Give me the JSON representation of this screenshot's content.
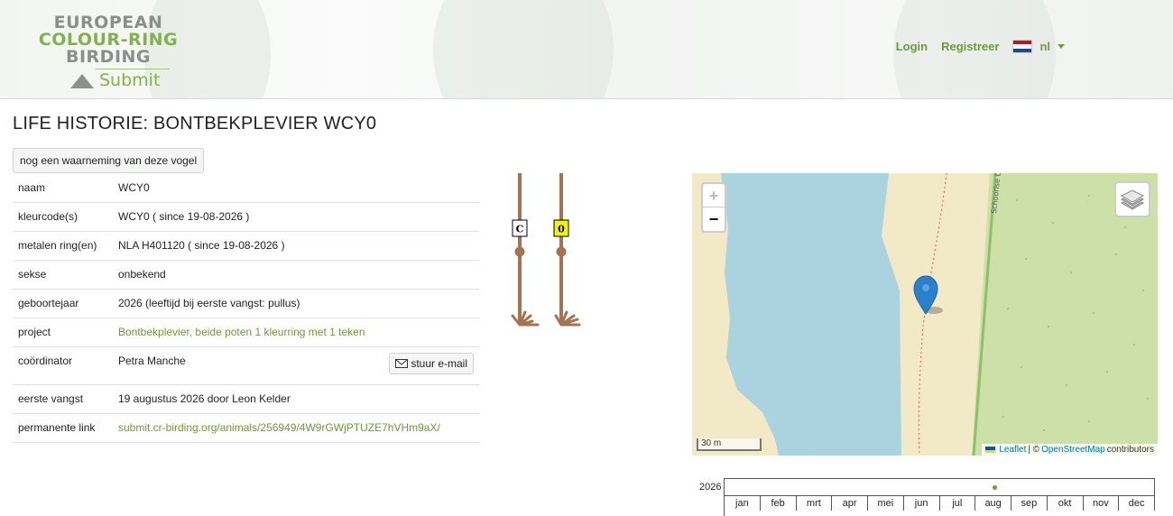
{
  "header": {
    "logo": {
      "line1": "EUROPEAN",
      "line2": "COLOUR-RING",
      "line3": "BIRDING",
      "submit": "Submit"
    },
    "nav": {
      "login": "Login",
      "register": "Registreer",
      "language": "nl"
    },
    "colors": {
      "accent": "#6f9a3a",
      "logo_green": "#7fb24a",
      "logo_grey": "#8a8f8a"
    }
  },
  "page_title": "LIFE HISTORIE: BONTBEKPLEVIER WCY0",
  "another_button": "nog een waarneming van deze vogel",
  "info": {
    "rows": [
      {
        "key": "naam",
        "value": "WCY0"
      },
      {
        "key": "kleurcode(s)",
        "value": "WCY0 ( since 19-08-2026 )"
      },
      {
        "key": "metalen ring(en)",
        "value": "NLA H401120 ( since 19-08-2026 )"
      },
      {
        "key": "sekse",
        "value": "onbekend"
      },
      {
        "key": "geboortejaar",
        "value": "2026 (leeftijd bij eerste vangst: pullus)"
      },
      {
        "key": "project",
        "value": "Bontbekplevier, beide poten 1 kleurring met 1 teken"
      },
      {
        "key": "coördinator",
        "value": "Petra Manche"
      },
      {
        "key": "eerste vangst",
        "value": "19 augustus 2026 door Leon Kelder"
      },
      {
        "key": "permanente link",
        "value": "submit.cr-birding.org/animals/256949/4W9rGWjPTUZE7hVHm9aX/"
      }
    ],
    "email_button": "stuur e-mail"
  },
  "legs": {
    "left_ring": {
      "code": "C",
      "color": "#ffffff"
    },
    "right_ring": {
      "code": "0",
      "color": "#f2f20a"
    },
    "leg_color": "#a57352"
  },
  "map": {
    "zoom_in": "+",
    "zoom_out": "−",
    "scale_label": "30 m",
    "street_label": "Schoorlse D",
    "attribution": {
      "leaflet": "Leaflet",
      "sep": "| ©",
      "osm": "OpenStreetMap",
      "contributors": "contributors"
    },
    "colors": {
      "water": "#aad3df",
      "sand": "#f2e9c7",
      "forest": "#cde0a8",
      "path": "#e05b5b",
      "marker": "#2a81cb"
    }
  },
  "timeline": {
    "year": "2026",
    "months": [
      "jan",
      "feb",
      "mrt",
      "apr",
      "mei",
      "jun",
      "jul",
      "aug",
      "sep",
      "okt",
      "nov",
      "dec"
    ],
    "observation_month": "aug"
  }
}
